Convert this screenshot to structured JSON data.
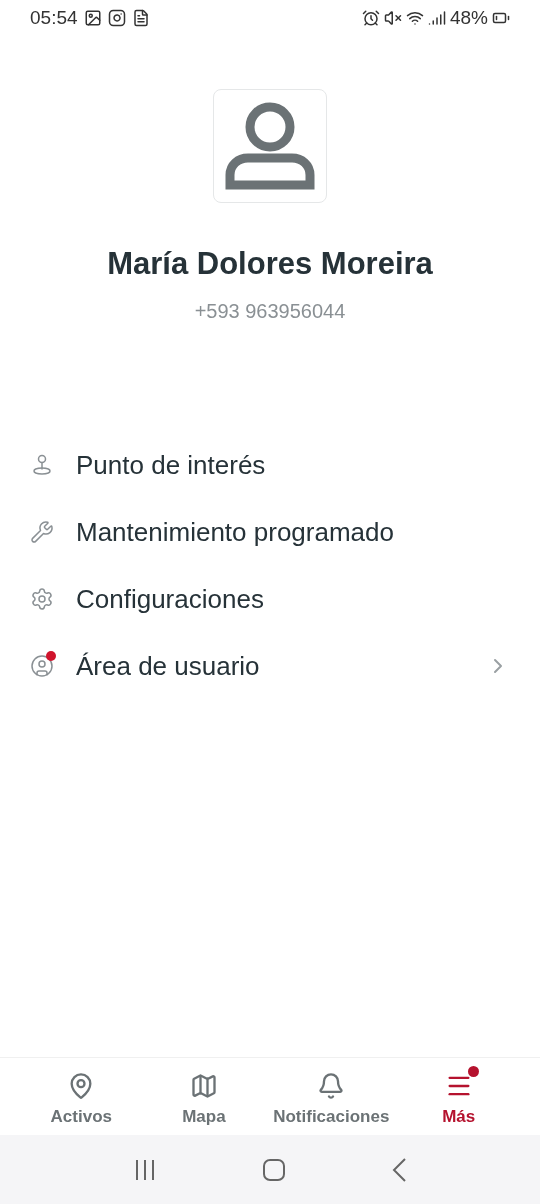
{
  "status_bar": {
    "time": "05:54",
    "battery": "48%"
  },
  "profile": {
    "name": "María Dolores Moreira",
    "phone": "+593 963956044"
  },
  "menu": [
    {
      "kind": "pin",
      "label": "Punto de interés",
      "badge": false,
      "chevron": false
    },
    {
      "kind": "wrench",
      "label": "Mantenimiento programado",
      "badge": false,
      "chevron": false
    },
    {
      "kind": "gear",
      "label": "Configuraciones",
      "badge": false,
      "chevron": false
    },
    {
      "kind": "user",
      "label": "Área de usuario",
      "badge": true,
      "chevron": true
    }
  ],
  "tabs": [
    {
      "kind": "location",
      "label": "Activos",
      "selected": false,
      "badge": false
    },
    {
      "kind": "map",
      "label": "Mapa",
      "selected": false,
      "badge": false
    },
    {
      "kind": "bell",
      "label": "Notificaciones",
      "selected": false,
      "badge": false
    },
    {
      "kind": "menu",
      "label": "Más",
      "selected": true,
      "badge": true
    }
  ]
}
